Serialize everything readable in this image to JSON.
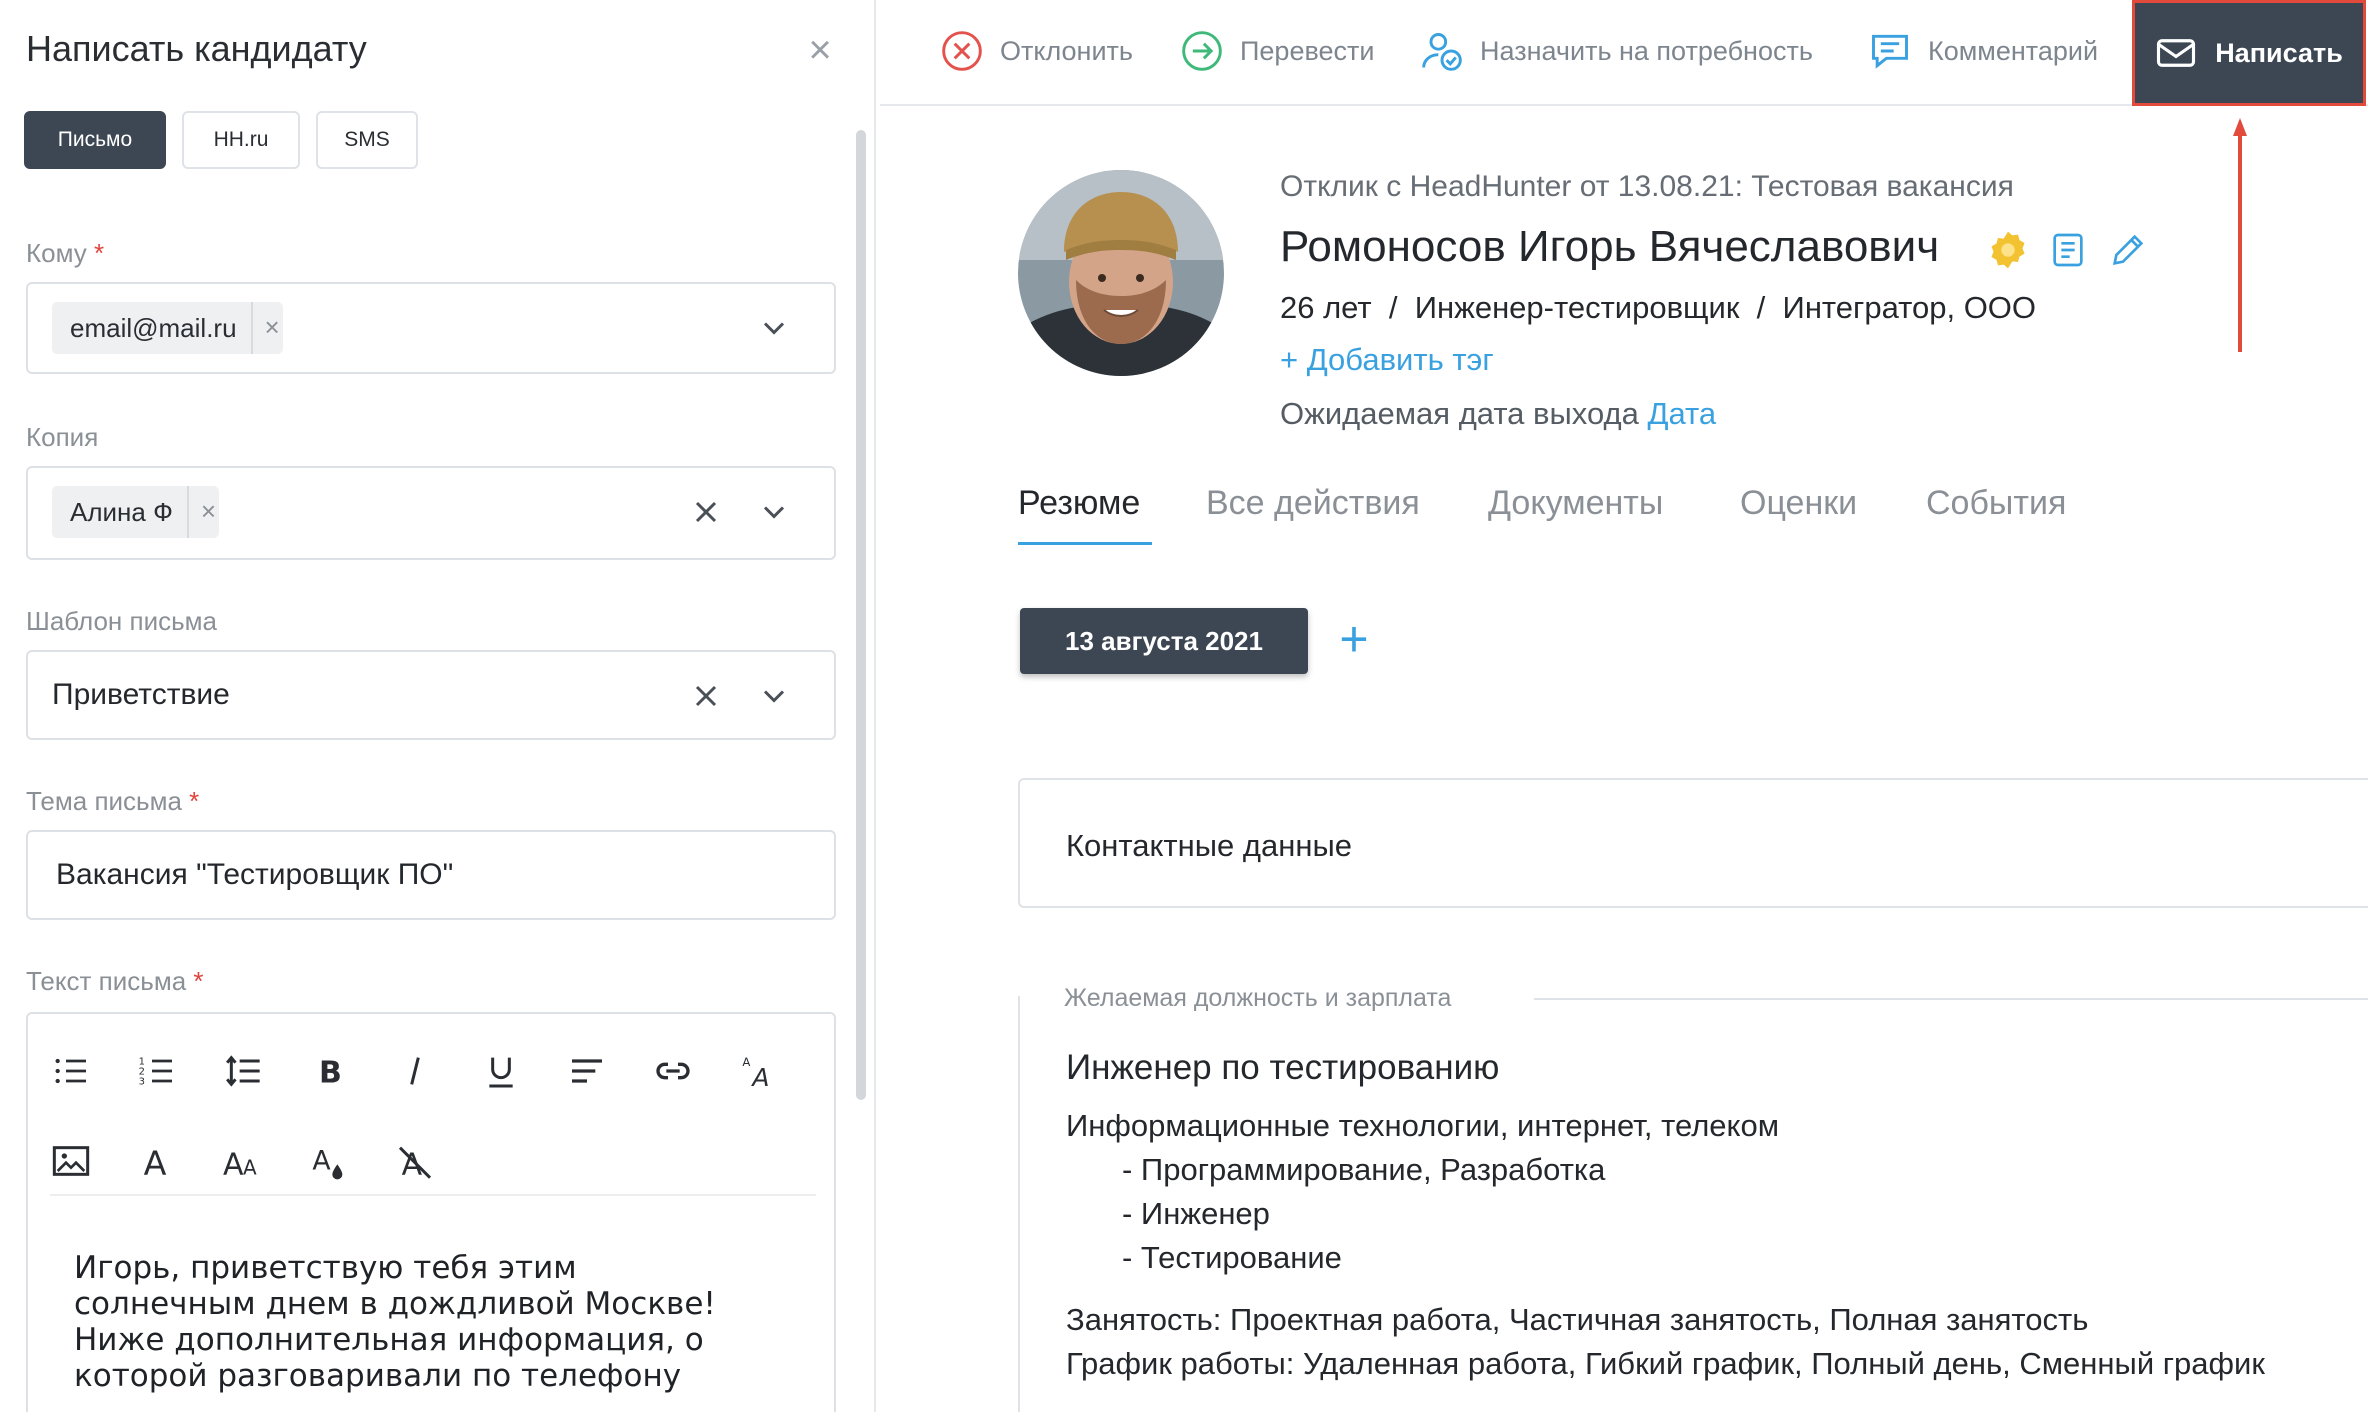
{
  "panel": {
    "title": "Написать кандидату",
    "channels": [
      "Письмо",
      "HH.ru",
      "SMS"
    ],
    "to": {
      "label": "Кому",
      "chip": "email@mail.ru"
    },
    "cc": {
      "label": "Копия",
      "chip": "Алина Ф"
    },
    "template": {
      "label": "Шаблон письма",
      "value": "Приветствие"
    },
    "subject": {
      "label": "Тема письма",
      "value": "Вакансия \"Тестировщик ПО\""
    },
    "body": {
      "label": "Текст письма",
      "lines": [
        "Игорь, приветствую тебя этим",
        "солнечным днем в дождливой Москве!",
        "Ниже дополнительная информация, о",
        "которой разговаривали по телефону"
      ]
    },
    "required_mark": "*"
  },
  "actions": {
    "reject": "Отклонить",
    "transfer": "Перевести",
    "assign": "Назначить на потребность",
    "comment": "Комментарий",
    "write": "Написать"
  },
  "candidate": {
    "source": "Отклик с HeadHunter от 13.08.21: Тестовая вакансия",
    "name": "Ромоносов Игорь Вячеславович",
    "age": "26 лет",
    "position": "Инженер-тестировщик",
    "company": "Интегратор, ООО",
    "separator": "/",
    "add_tag": "+ Добавить тэг",
    "expected_date_label": "Ожидаемая дата выхода",
    "expected_date_link": "Дата"
  },
  "tabs": [
    "Резюме",
    "Все действия",
    "Документы",
    "Оценки",
    "События"
  ],
  "resume": {
    "date": "13 августа 2021",
    "add": "+",
    "contacts_title": "Контактные данные",
    "section_title": "Желаемая должность и зарплата",
    "desired_position": "Инженер по тестированию",
    "industry": "Информационные технологии, интернет, телеком",
    "specializations": [
      "- Программирование, Разработка",
      "- Инженер",
      "- Тестирование"
    ],
    "employment": "Занятость: Проектная работа, Частичная занятость, Полная занятость",
    "schedule": "График работы: Удаленная работа, Гибкий график, Полный день, Сменный график"
  },
  "colors": {
    "accent_dark": "#3c4753",
    "link_blue": "#3aa1e0",
    "highlight_red": "#e24a3b",
    "verified_gold": "#f2c230"
  },
  "icons": [
    "close-icon",
    "chevron-down-icon",
    "clear-icon",
    "reject-icon",
    "transfer-icon",
    "assign-icon",
    "comment-icon",
    "mail-icon",
    "verified-icon",
    "resume-icon",
    "edit-icon"
  ]
}
